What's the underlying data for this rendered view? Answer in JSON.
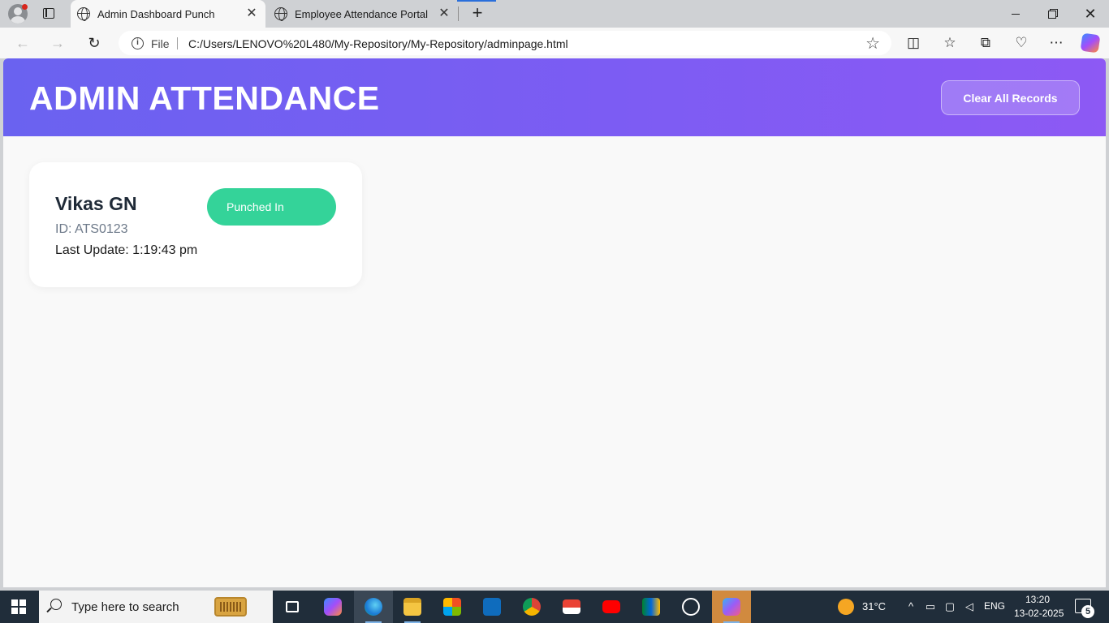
{
  "browser": {
    "tabs": [
      {
        "title": "Admin Dashboard Punch",
        "active": true
      },
      {
        "title": "Employee Attendance Portal",
        "active": false
      }
    ],
    "address": {
      "scheme_label": "File",
      "url": "C:/Users/LENOVO%20L480/My-Repository/My-Repository/adminpage.html"
    },
    "close_glyph": "✕",
    "new_tab_glyph": "+"
  },
  "page": {
    "header_title": "ADMIN ATTENDANCE",
    "clear_button_label": "Clear All Records",
    "colors": {
      "header_gradient_start": "#6a62f0",
      "header_gradient_end": "#8d59f4",
      "status_punched_in": "#34d399",
      "page_bg": "#f9f9f9"
    },
    "employees": [
      {
        "name": "Vikas GN",
        "id_text": "ID: ATS0123",
        "last_update_text": "Last Update: 1:19:43 pm",
        "status": "Punched In"
      }
    ]
  },
  "taskbar": {
    "search_placeholder": "Type here to search",
    "apps": [
      "task-view",
      "copilot",
      "edge",
      "file-explorer",
      "microsoft-store",
      "outlook",
      "chrome",
      "gmail",
      "youtube",
      "google-meet",
      "chatgpt",
      "microsoft-365"
    ],
    "weather": "31°C",
    "language": "ENG",
    "time": "13:20",
    "date": "13-02-2025",
    "notification_count": "5"
  }
}
